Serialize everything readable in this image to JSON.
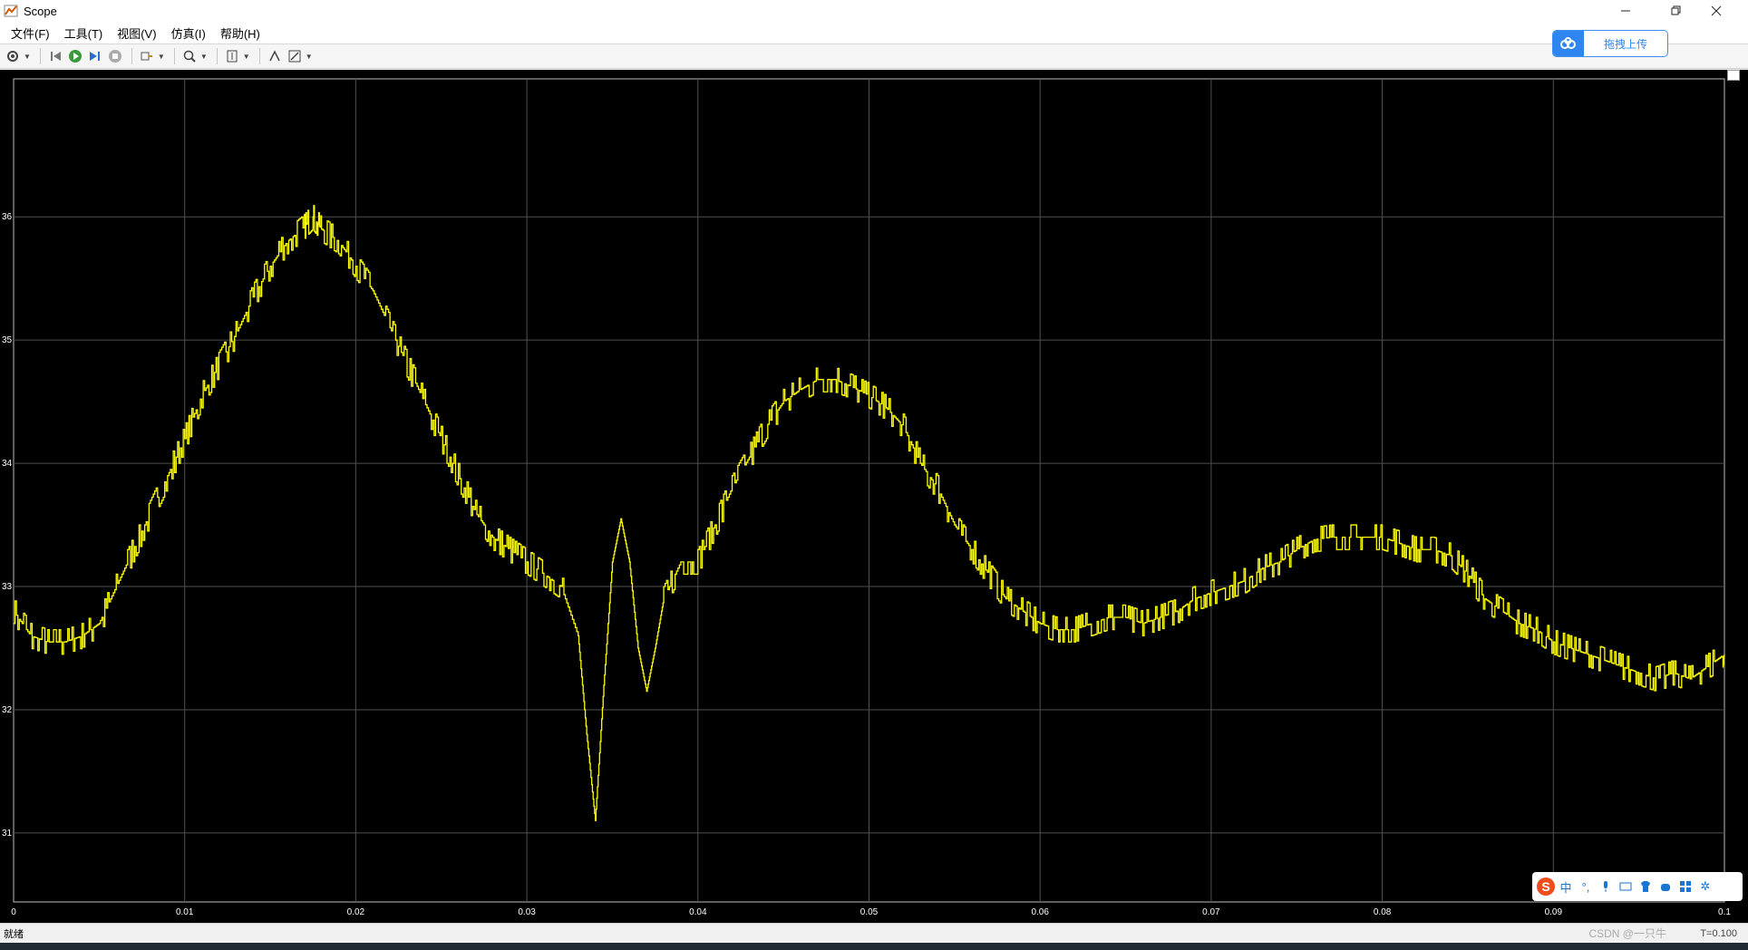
{
  "window": {
    "title": "Scope"
  },
  "menu": [
    {
      "label": "文件(F)"
    },
    {
      "label": "工具(T)"
    },
    {
      "label": "视图(V)"
    },
    {
      "label": "仿真(I)"
    },
    {
      "label": "帮助(H)"
    }
  ],
  "toolbar": {
    "icons": [
      "gear-icon",
      "rewind-icon",
      "run-icon",
      "step-forward-icon",
      "stop-icon",
      "highlight-icon",
      "zoom-icon",
      "autoscale-icon",
      "cursor-icon",
      "edit-icon"
    ]
  },
  "upload": {
    "label": "拖拽上传"
  },
  "status": {
    "text": "就绪",
    "right": "T=0.100",
    "watermark": "CSDN @一只牛"
  },
  "chart_data": {
    "type": "line",
    "title": "",
    "xlabel": "",
    "ylabel": "",
    "xlim": [
      0,
      0.1
    ],
    "ylim": [
      30.44,
      37.12
    ],
    "x_ticks": [
      "0",
      "0.01",
      "0.02",
      "0.03",
      "0.04",
      "0.05",
      "0.06",
      "0.07",
      "0.08",
      "0.09",
      "0.1"
    ],
    "y_ticks": [
      "31",
      "32",
      "33",
      "34",
      "35",
      "36"
    ],
    "grid": true,
    "background": "#000000",
    "grid_color": "#505050",
    "line_color": "#ffff00",
    "series": [
      {
        "name": "",
        "x": [
          0,
          0.001,
          0.002,
          0.003,
          0.004,
          0.005,
          0.006,
          0.007,
          0.008,
          0.009,
          0.01,
          0.011,
          0.012,
          0.013,
          0.014,
          0.015,
          0.016,
          0.017,
          0.0175,
          0.018,
          0.019,
          0.02,
          0.021,
          0.022,
          0.023,
          0.024,
          0.025,
          0.026,
          0.027,
          0.028,
          0.029,
          0.03,
          0.031,
          0.032,
          0.033,
          0.0335,
          0.034,
          0.0345,
          0.035,
          0.0355,
          0.036,
          0.0365,
          0.037,
          0.0375,
          0.038,
          0.039,
          0.04,
          0.041,
          0.042,
          0.043,
          0.044,
          0.045,
          0.046,
          0.047,
          0.048,
          0.049,
          0.05,
          0.051,
          0.052,
          0.053,
          0.054,
          0.055,
          0.056,
          0.057,
          0.058,
          0.059,
          0.06,
          0.061,
          0.062,
          0.063,
          0.064,
          0.065,
          0.066,
          0.067,
          0.068,
          0.069,
          0.07,
          0.071,
          0.072,
          0.073,
          0.074,
          0.075,
          0.076,
          0.077,
          0.078,
          0.079,
          0.08,
          0.081,
          0.082,
          0.083,
          0.084,
          0.085,
          0.086,
          0.087,
          0.088,
          0.089,
          0.09,
          0.091,
          0.092,
          0.093,
          0.094,
          0.095,
          0.096,
          0.097,
          0.098,
          0.099,
          0.1
        ],
        "y": [
          32.8,
          32.6,
          32.55,
          32.55,
          32.6,
          32.7,
          33.0,
          33.3,
          33.6,
          33.9,
          34.2,
          34.55,
          34.8,
          35.05,
          35.35,
          35.6,
          35.8,
          35.92,
          36.0,
          35.9,
          35.8,
          35.6,
          35.4,
          35.1,
          34.8,
          34.5,
          34.2,
          33.9,
          33.6,
          33.4,
          33.3,
          33.2,
          33.1,
          33.0,
          32.6,
          31.8,
          31.1,
          32.2,
          33.2,
          33.55,
          33.2,
          32.5,
          32.15,
          32.5,
          32.9,
          33.2,
          33.2,
          33.5,
          33.8,
          34.05,
          34.3,
          34.5,
          34.6,
          34.68,
          34.68,
          34.62,
          34.55,
          34.45,
          34.3,
          34.0,
          33.8,
          33.5,
          33.3,
          33.1,
          32.9,
          32.8,
          32.7,
          32.65,
          32.65,
          32.7,
          32.75,
          32.75,
          32.7,
          32.75,
          32.8,
          32.9,
          32.95,
          33.0,
          33.05,
          33.15,
          33.2,
          33.3,
          33.38,
          33.4,
          33.4,
          33.4,
          33.4,
          33.35,
          33.3,
          33.3,
          33.25,
          33.1,
          32.9,
          32.8,
          32.7,
          32.65,
          32.55,
          32.5,
          32.45,
          32.4,
          32.35,
          32.3,
          32.25,
          32.3,
          32.25,
          32.35,
          32.45
        ]
      }
    ]
  }
}
